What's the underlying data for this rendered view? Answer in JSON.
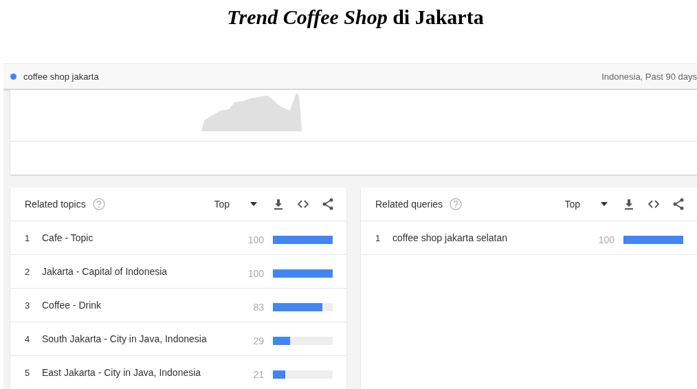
{
  "document_title": "*Trend Coffee Shop* di Jakarta",
  "search_term": {
    "label": "coffee shop jakarta",
    "color": "#4285f4"
  },
  "scope": "Indonesia, Past 90 days",
  "panels": [
    {
      "title": "Related topics",
      "filter": "Top",
      "rows": [
        {
          "rank": "1",
          "label": "Cafe - Topic",
          "value": "100",
          "level": 1.0
        },
        {
          "rank": "2",
          "label": "Jakarta - Capital of Indonesia",
          "value": "100",
          "level": 1.0
        },
        {
          "rank": "3",
          "label": "Coffee - Drink",
          "value": "83",
          "level": 0.83
        },
        {
          "rank": "4",
          "label": "South Jakarta - City in Java, Indonesia",
          "value": "29",
          "level": 0.29
        },
        {
          "rank": "5",
          "label": "East Jakarta - City in Java, Indonesia",
          "value": "21",
          "level": 0.21
        }
      ]
    },
    {
      "title": "Related queries",
      "filter": "Top",
      "rows": [
        {
          "rank": "1",
          "label": "coffee shop jakarta selatan",
          "value": "100",
          "level": 1.0
        }
      ]
    }
  ]
}
